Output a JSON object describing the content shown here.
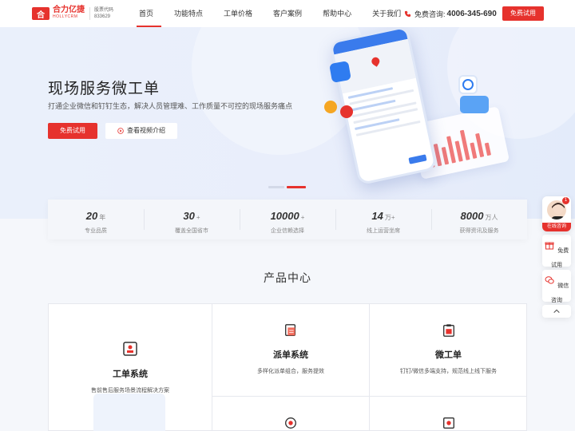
{
  "header": {
    "logo_mark": "合",
    "logo_cn": "合力亿捷",
    "logo_en": "HOLLYCRM",
    "stock_label": "股票代码",
    "stock_code": "833629",
    "nav": [
      "首页",
      "功能特点",
      "工单价格",
      "客户案例",
      "帮助中心",
      "关于我们"
    ],
    "hotline_label": "免费咨询:",
    "hotline_number": "4006-345-690",
    "trial_label": "免费试用"
  },
  "hero": {
    "title": "现场服务微工单",
    "subtitle": "打通企业微信和钉钉生态，解决人员管理难、工作质量不可控的现场服务痛点",
    "btn_trial": "免费试用",
    "btn_video": "查看视频介绍"
  },
  "stats": [
    {
      "value": "20",
      "unit": "年",
      "label": "专业品质"
    },
    {
      "value": "30",
      "unit": "+",
      "label": "覆盖全国省市"
    },
    {
      "value": "10000",
      "unit": "+",
      "label": "企业信赖选择"
    },
    {
      "value": "14",
      "unit": "万+",
      "label": "线上运营坐席"
    },
    {
      "value": "8000",
      "unit": "万人",
      "label": "获得资讯及服务"
    }
  ],
  "products": {
    "title": "产品中心",
    "big": {
      "title": "工单系统",
      "desc": "售前售后服务场景流程解决方案"
    },
    "items": [
      {
        "title": "派单系统",
        "desc": "多样化派单组合，服务提效"
      },
      {
        "title": "微工单",
        "desc": "钉钉/微信多端支持，规范线上线下服务"
      }
    ]
  },
  "sidebar": {
    "badge": "1",
    "online": "在线咨询",
    "trial": "免费试用",
    "wechat": "微信咨询"
  },
  "colors": {
    "brand": "#e6322d",
    "accent": "#3a7bec"
  }
}
